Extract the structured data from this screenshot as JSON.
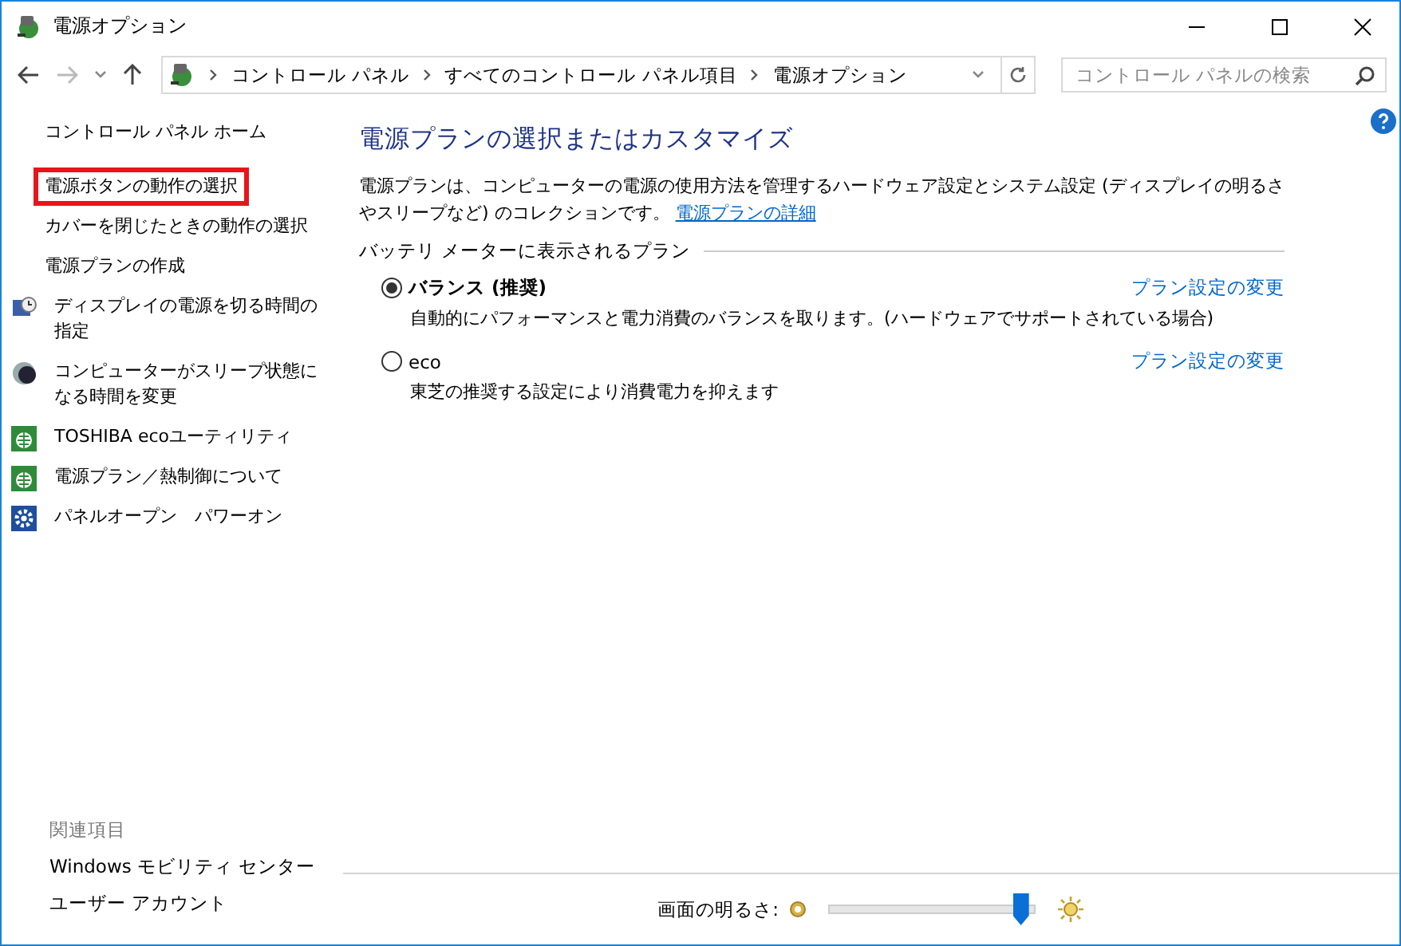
{
  "window": {
    "title": "電源オプション"
  },
  "address_bar": {
    "crumbs": [
      "コントロール パネル",
      "すべてのコントロール パネル項目",
      "電源オプション"
    ],
    "search_placeholder": "コントロール パネルの検索"
  },
  "sidebar": {
    "items": [
      {
        "label": "コントロール パネル ホーム",
        "kind": "text",
        "highlighted": false
      },
      {
        "label": "電源ボタンの動作の選択",
        "kind": "text",
        "highlighted": true
      },
      {
        "label": "カバーを閉じたときの動作の選択",
        "kind": "text",
        "highlighted": false
      },
      {
        "label": "電源プランの作成",
        "kind": "text",
        "highlighted": false
      },
      {
        "label": "ディスプレイの電源を切る時間の指定",
        "kind": "display",
        "highlighted": false
      },
      {
        "label": "コンピューターがスリープ状態になる時間を変更",
        "kind": "moon",
        "highlighted": false
      },
      {
        "label": "TOSHIBA ecoユーティリティ",
        "kind": "eco",
        "highlighted": false
      },
      {
        "label": "電源プラン／熱制御について",
        "kind": "eco",
        "highlighted": false
      },
      {
        "label": "パネルオープン　パワーオン",
        "kind": "gear",
        "highlighted": false
      }
    ],
    "related_heading": "関連項目",
    "related": [
      "Windows モビリティ センター",
      "ユーザー アカウント"
    ]
  },
  "main": {
    "heading": "電源プランの選択またはカスタマイズ",
    "description": "電源プランは、コンピューターの電源の使用方法を管理するハードウェア設定とシステム設定 (ディスプレイの明るさやスリープなど) のコレクションです。",
    "details_link": "電源プランの詳細",
    "group_label": "バッテリ メーターに表示されるプラン",
    "plans": [
      {
        "name": "バランス (推奨)",
        "selected": true,
        "description": "自動的にパフォーマンスと電力消費のバランスを取ります。(ハードウェアでサポートされている場合)",
        "link": "プラン設定の変更"
      },
      {
        "name": "eco",
        "selected": false,
        "description": "東芝の推奨する設定により消費電力を抑えます",
        "link": "プラン設定の変更"
      }
    ]
  },
  "brightness": {
    "label": "画面の明るさ:",
    "level": 0.93
  }
}
